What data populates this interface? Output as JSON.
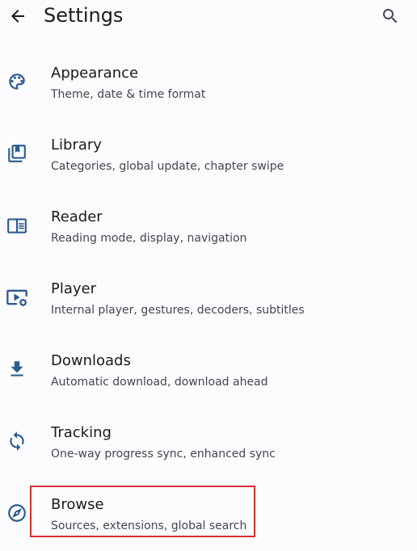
{
  "header": {
    "title": "Settings",
    "back_icon": "arrow-back-icon",
    "search_icon": "search-icon"
  },
  "accent_color": "#2c5d8f",
  "highlight_color": "#d32f2f",
  "items": [
    {
      "title": "Appearance",
      "subtitle": "Theme, date & time format",
      "icon": "palette-icon"
    },
    {
      "title": "Library",
      "subtitle": "Categories, global update, chapter swipe",
      "icon": "library-icon"
    },
    {
      "title": "Reader",
      "subtitle": "Reading mode, display, navigation",
      "icon": "book-open-icon"
    },
    {
      "title": "Player",
      "subtitle": "Internal player, gestures, decoders, subtitles",
      "icon": "video-settings-icon"
    },
    {
      "title": "Downloads",
      "subtitle": "Automatic download, download ahead",
      "icon": "download-icon"
    },
    {
      "title": "Tracking",
      "subtitle": "One-way progress sync, enhanced sync",
      "icon": "sync-icon"
    },
    {
      "title": "Browse",
      "subtitle": "Sources, extensions, global search",
      "icon": "compass-icon"
    }
  ]
}
